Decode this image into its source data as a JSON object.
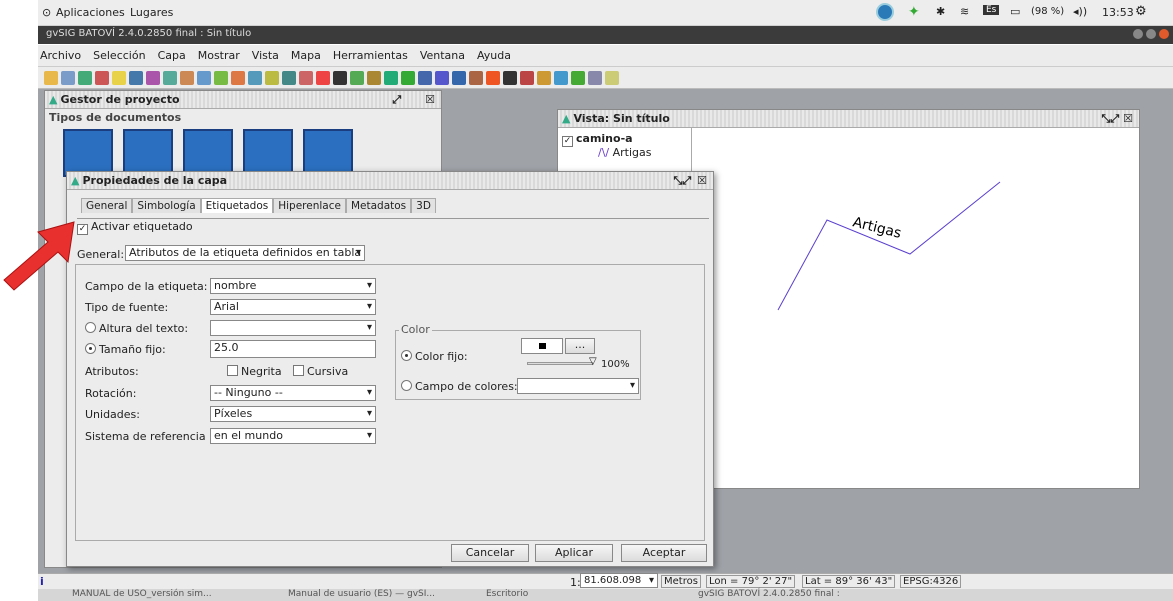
{
  "topbar": {
    "apps": "Aplicaciones",
    "places": "Lugares",
    "lang": "Es",
    "battery": "(98 %)",
    "time": "13:53"
  },
  "window": {
    "title": "gvSIG BATOVÍ 2.4.0.2850 final : Sin título"
  },
  "menu": [
    "Archivo",
    "Selección",
    "Capa",
    "Mostrar",
    "Vista",
    "Mapa",
    "Herramientas",
    "Ventana",
    "Ayuda"
  ],
  "project": {
    "title": "Gestor de proyecto",
    "doc_types": "Tipos de documentos"
  },
  "view": {
    "title": "Vista: Sin título",
    "layer": "camino-a",
    "sublayer": "Artigas",
    "map_label": "Artigas"
  },
  "dialog": {
    "title": "Propiedades de la capa",
    "tabs": [
      "General",
      "Simbología",
      "Etiquetados",
      "Hiperenlace",
      "Metadatos",
      "3D"
    ],
    "activate": "Activar etiquetado",
    "general_label": "General:",
    "general_value": "Atributos de la etiqueta definidos en tabla",
    "campo_label": "Campo de la etiqueta:",
    "campo_value": "nombre",
    "fuente_label": "Tipo de fuente:",
    "fuente_value": "Arial",
    "altura_label": "Altura del texto:",
    "tamano_label": "Tamaño fijo:",
    "tamano_value": "25.0",
    "atributos_label": "Atributos:",
    "negrita": "Negrita",
    "cursiva": "Cursiva",
    "rotacion_label": "Rotación:",
    "rotacion_value": "-- Ninguno --",
    "unidades_label": "Unidades:",
    "unidades_value": "Píxeles",
    "sistema_label": "Sistema de referencia",
    "sistema_value": "en el mundo",
    "color_legend": "Color",
    "color_fijo": "Color fijo:",
    "color_btn": "...",
    "percent": "100%",
    "campo_colores": "Campo de colores:",
    "cancel": "Cancelar",
    "apply": "Aplicar",
    "accept": "Aceptar"
  },
  "status": {
    "scale_prefix": "1:",
    "scale": "81.608.098",
    "units": "Metros",
    "lon": "Lon = 79° 2' 27\"",
    "lat": "Lat = 89° 36' 43\"",
    "epsg": "EPSG:4326"
  },
  "taskbar": [
    "MANUAL de USO_versión sim...",
    "Manual de usuario (ES) — gvSI...",
    "Escritorio",
    "gvSIG BATOVÍ 2.4.0.2850 final :"
  ]
}
